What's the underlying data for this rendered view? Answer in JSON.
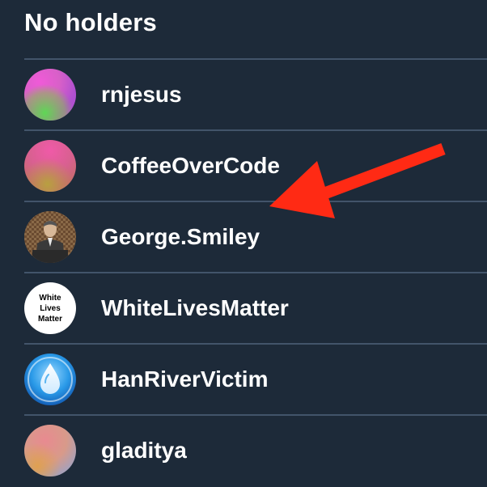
{
  "header": {
    "title": "No holders"
  },
  "holders": [
    {
      "name": "rnjesus",
      "avatar": "gradient-avatar-pink-green"
    },
    {
      "name": "CoffeeOverCode",
      "avatar": "gradient-avatar-pink-olive"
    },
    {
      "name": "George.Smiley",
      "avatar": "photo-avatar-man"
    },
    {
      "name": "WhiteLivesMatter",
      "avatar": "text-avatar",
      "avatar_text": [
        "White",
        "Lives",
        "Matter"
      ]
    },
    {
      "name": "HanRiverVictim",
      "avatar": "water-drop-icon"
    },
    {
      "name": "gladitya",
      "avatar": "gradient-avatar-peach"
    }
  ],
  "annotation": {
    "arrow_color": "#ff2a14",
    "icon": "red-arrow-icon"
  },
  "colors": {
    "background": "#1d2a39",
    "divider": "#42546a",
    "text": "#ffffff"
  }
}
